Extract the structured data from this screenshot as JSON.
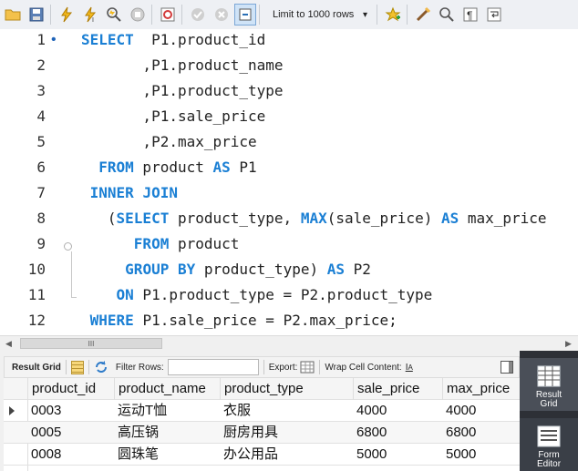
{
  "toolbar": {
    "icons": [
      "open-folder-icon",
      "save-icon",
      "execute-icon",
      "execute-current-icon",
      "explain-icon",
      "stop-icon",
      "toggle-error-icon",
      "commit-icon",
      "rollback-icon",
      "autocommit-icon",
      "add-snippet-icon",
      "beautify-icon",
      "find-icon",
      "invisible-chars-icon",
      "wrap-icon"
    ],
    "limit_label": "Limit to 1000 rows",
    "limit_arrow": "▾"
  },
  "editor": {
    "lines": [
      {
        "num": "1",
        "bullet": "•",
        "parts": [
          [
            "kw",
            "SELECT"
          ],
          [
            "t",
            "  P1.product_id"
          ]
        ]
      },
      {
        "num": "2",
        "parts": [
          [
            "t",
            "       ,P1.product_name"
          ]
        ]
      },
      {
        "num": "3",
        "parts": [
          [
            "t",
            "       ,P1.product_type"
          ]
        ]
      },
      {
        "num": "4",
        "parts": [
          [
            "t",
            "       ,P1.sale_price"
          ]
        ]
      },
      {
        "num": "5",
        "parts": [
          [
            "t",
            "       ,P2.max_price"
          ]
        ]
      },
      {
        "num": "6",
        "parts": [
          [
            "t",
            "  "
          ],
          [
            "kw",
            "FROM"
          ],
          [
            "t",
            " product "
          ],
          [
            "kw",
            "AS"
          ],
          [
            "t",
            " P1"
          ]
        ]
      },
      {
        "num": "7",
        "parts": [
          [
            "t",
            " "
          ],
          [
            "kw",
            "INNER JOIN"
          ]
        ]
      },
      {
        "num": "8",
        "parts": [
          [
            "t",
            "   ("
          ],
          [
            "kw",
            "SELECT"
          ],
          [
            "t",
            " product_type, "
          ],
          [
            "kw",
            "MAX"
          ],
          [
            "t",
            "(sale_price) "
          ],
          [
            "kw",
            "AS"
          ],
          [
            "t",
            " max_price"
          ]
        ]
      },
      {
        "num": "9",
        "parts": [
          [
            "t",
            "      "
          ],
          [
            "kw",
            "FROM"
          ],
          [
            "t",
            " product"
          ]
        ]
      },
      {
        "num": "10",
        "parts": [
          [
            "t",
            "     "
          ],
          [
            "kw",
            "GROUP BY"
          ],
          [
            "t",
            " product_type) "
          ],
          [
            "kw",
            "AS"
          ],
          [
            "t",
            " P2"
          ]
        ]
      },
      {
        "num": "11",
        "parts": [
          [
            "t",
            "    "
          ],
          [
            "kw",
            "ON"
          ],
          [
            "t",
            " P1.product_type = P2.product_type"
          ]
        ]
      },
      {
        "num": "12",
        "parts": [
          [
            "t",
            " "
          ],
          [
            "kw",
            "WHERE"
          ],
          [
            "t",
            " P1.sale_price = P2.max_price;"
          ]
        ]
      }
    ]
  },
  "scrollbar": {
    "thumb_grip": "III",
    "left_arrow": "◀",
    "right_arrow": "▶"
  },
  "result_toolbar": {
    "result_grid_label": "Result Grid",
    "filter_rows_label": "Filter Rows:",
    "filter_value": "",
    "export_label": "Export:",
    "wrap_label": "Wrap Cell Content:"
  },
  "grid": {
    "columns": [
      "product_id",
      "product_name",
      "product_type",
      "sale_price",
      "max_price"
    ],
    "rows": [
      [
        "0003",
        "运动T恤",
        "衣服",
        "4000",
        "4000"
      ],
      [
        "0005",
        "高压锅",
        "厨房用具",
        "6800",
        "6800"
      ],
      [
        "0008",
        "圆珠笔",
        "办公用品",
        "5000",
        "5000"
      ]
    ]
  },
  "side_panel": {
    "result_grid_btn": "Result Grid",
    "form_editor_btn": "Form Editor"
  },
  "colors": {
    "keyword": "#1a7fd4",
    "side_panel": "#2d3036"
  }
}
